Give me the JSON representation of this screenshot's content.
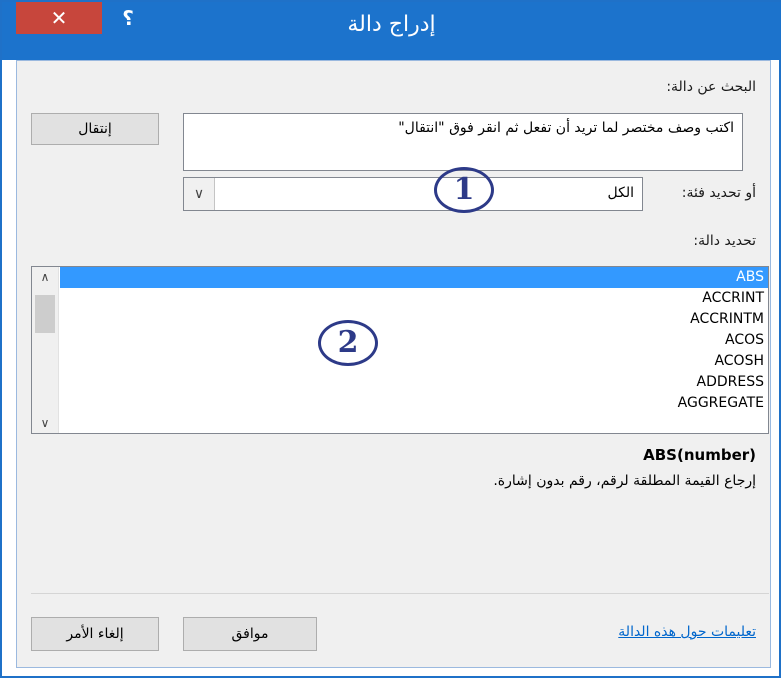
{
  "dialog": {
    "title": "إدراج دالة",
    "close_label": "✕",
    "help_label": "؟"
  },
  "search": {
    "label": "البحث عن دالة:",
    "value": "اكتب وصف مختصر لما تريد أن تفعل ثم انقر فوق \"انتقال\"",
    "go_button": "إنتقال"
  },
  "category": {
    "label": "أو تحديد فئة:",
    "selected": "الكل"
  },
  "functions": {
    "label": "تحديد دالة:",
    "items": [
      "ABS",
      "ACCRINT",
      "ACCRINTM",
      "ACOS",
      "ACOSH",
      "ADDRESS",
      "AGGREGATE"
    ],
    "selected_index": 0
  },
  "details": {
    "syntax": "ABS(number)",
    "description": "إرجاع القيمة المطلقة لرقم، رقم بدون إشارة."
  },
  "footer": {
    "help_link": "تعليمات حول هذه الدالة",
    "ok_button": "موافق",
    "cancel_button": "إلغاء الأمر"
  },
  "annotations": {
    "marker_1": "1",
    "marker_2": "2"
  },
  "colors": {
    "title_bar": "#1c73cc",
    "close_button": "#c7463c",
    "selection": "#3399ff",
    "link": "#0066cc",
    "annotation": "#2d3a88"
  }
}
